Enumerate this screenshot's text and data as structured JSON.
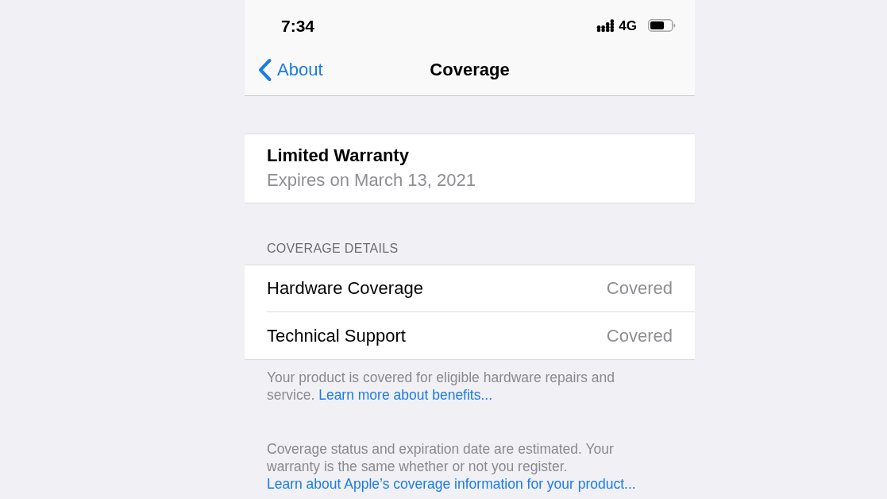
{
  "status_bar": {
    "time": "7:34",
    "network": "4G"
  },
  "nav_bar": {
    "back": "About",
    "title": "Coverage"
  },
  "warranty": {
    "title": "Limited Warranty",
    "subtitle": "Expires on March 13, 2021"
  },
  "coverage_details": {
    "header": "COVERAGE DETAILS",
    "rows": [
      {
        "label": "Hardware Coverage",
        "value": "Covered"
      },
      {
        "label": "Technical Support",
        "value": "Covered"
      }
    ]
  },
  "notes": [
    {
      "text": "Your product is covered for eligible hardware repairs and service.",
      "link": "Learn more about benefits..."
    },
    {
      "text": "Coverage status and expiration date are estimated. Your warranty is the same whether or not you register.",
      "link": "Learn about Apple’s coverage information for your product..."
    }
  ]
}
